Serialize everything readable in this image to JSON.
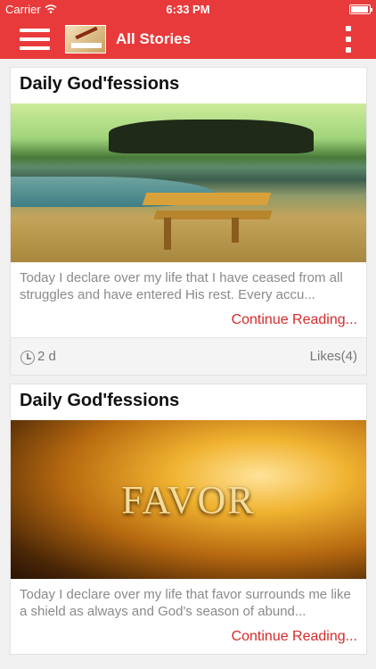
{
  "status_bar": {
    "carrier": "Carrier",
    "time": "6:33 PM",
    "battery_level": 0.9
  },
  "nav_bar": {
    "title": "All Stories",
    "menu_icon": "hamburger-menu-icon",
    "more_icon": "vertical-dots-icon",
    "logo_icon": "app-logo-icon"
  },
  "stories": [
    {
      "title": "Daily God'fessions",
      "image_desc": "",
      "excerpt": "Today I declare over my life that I have ceased from all struggles and have entered His rest. Every accu...",
      "more_label": "Continue Reading...",
      "time": "2 d",
      "likes": "Likes(4)"
    },
    {
      "title": "Daily God'fessions",
      "image_word": "FAVOR",
      "excerpt": "Today I declare over my life that favor surrounds me like a shield as always and God's season of abund...",
      "more_label": "Continue Reading..."
    }
  ],
  "colors": {
    "brand": "#e83a3a",
    "link": "#d42a2a"
  }
}
